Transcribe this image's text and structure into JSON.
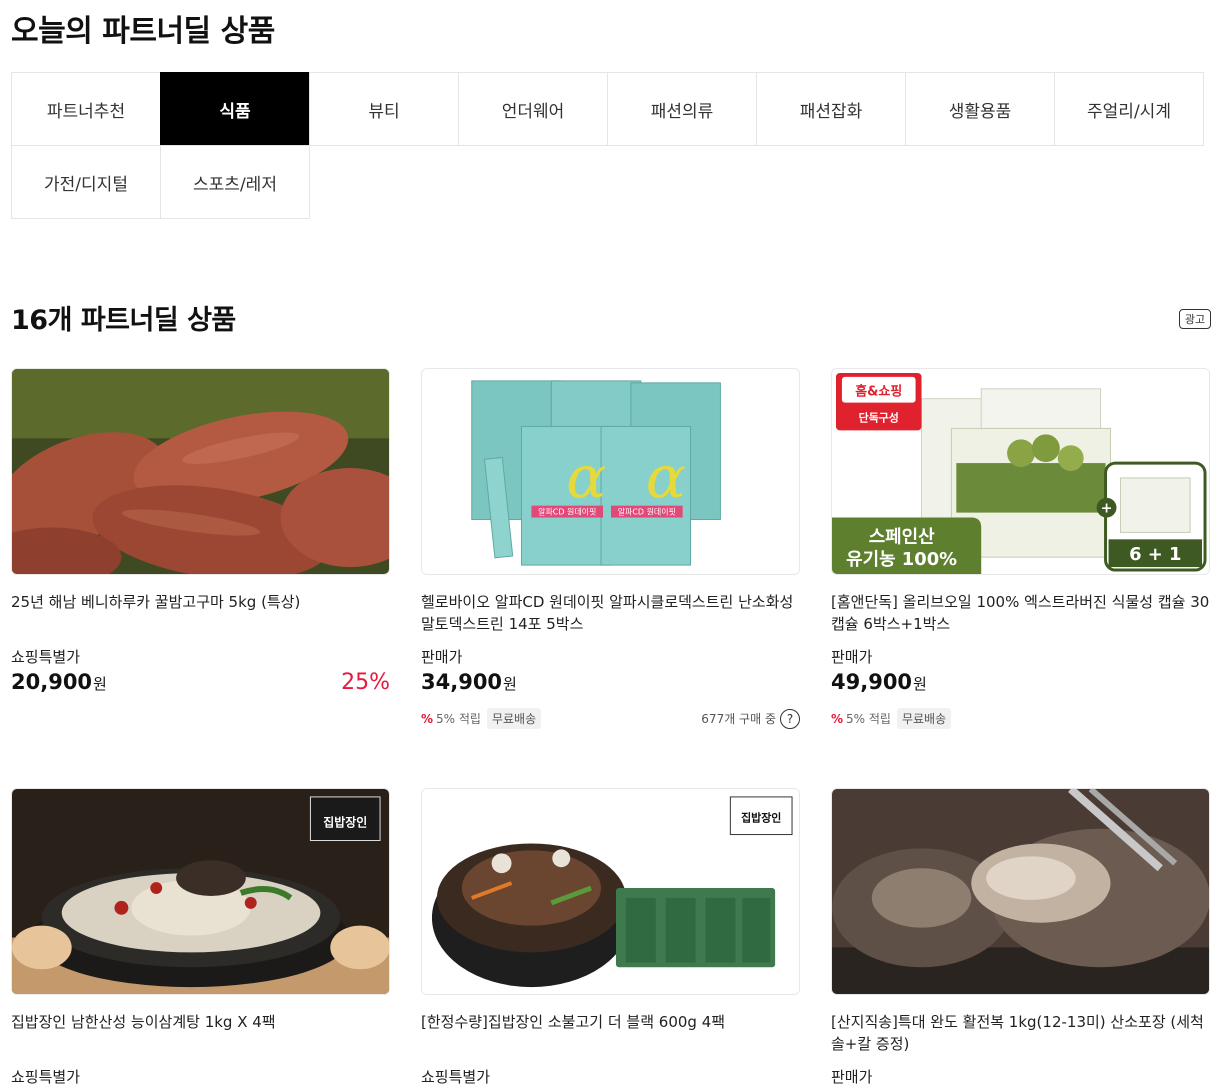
{
  "page_title": "오늘의 파트너딜 상품",
  "categories_row1": [
    {
      "label": "파트너추천",
      "active": false
    },
    {
      "label": "식품",
      "active": true
    },
    {
      "label": "뷰티",
      "active": false
    },
    {
      "label": "언더웨어",
      "active": false
    },
    {
      "label": "패션의류",
      "active": false
    },
    {
      "label": "패션잡화",
      "active": false
    },
    {
      "label": "생활용품",
      "active": false
    },
    {
      "label": "주얼리/시계",
      "active": false
    }
  ],
  "categories_row2": [
    {
      "label": "가전/디지털",
      "active": false
    },
    {
      "label": "스포츠/레저",
      "active": false
    }
  ],
  "section_title": "16개 파트너딜 상품",
  "ad_badge": "광고",
  "products": [
    {
      "name": "25년 해남 베니하루카 꿀밤고구마 5kg (특상)",
      "price_label": "쇼핑특별가",
      "price": "20,900",
      "currency": "원",
      "discount": "25%"
    },
    {
      "name": "헬로바이오 알파CD 원데이핏 알파시클로덱스트린 난소화성말토덱스트린 14포 5박스",
      "price_label": "판매가",
      "price": "34,900",
      "currency": "원",
      "point_pct": "%",
      "point_text": "5% 적립",
      "free_ship": "무료배송",
      "buy_count": "677개 구매 중",
      "help": "?"
    },
    {
      "name": "[홈앤단독] 올리브오일 100% 엑스트라버진 식물성 캡슐 30캡슐 6박스+1박스",
      "price_label": "판매가",
      "price": "49,900",
      "currency": "원",
      "point_pct": "%",
      "point_text": "5% 적립",
      "free_ship": "무료배송"
    },
    {
      "name": "집밥장인 남한산성 능이삼계탕 1kg X 4팩",
      "price_label": "쇼핑특별가"
    },
    {
      "name": "[한정수량]집밥장인 소불고기 더 블랙 600g 4팩",
      "price_label": "쇼핑특별가"
    },
    {
      "name": "[산지직송]특대 완도 활전복 1kg(12-13미) 산소포장 (세척솔+칼 증정)",
      "price_label": "판매가"
    }
  ],
  "image_text": {
    "homeshop_logo": "홈&쇼핑",
    "homeshop_sub": "단독구성",
    "olive_banner_1": "스페인산",
    "olive_banner_2": "유기농 100%",
    "olive_bonus": "6 + 1",
    "alpha_box_label": "알파CD 원데이핏",
    "jipbap_logo": "집밥장인"
  },
  "colors": {
    "accent_red": "#e8193c",
    "active_tab_bg": "#000000"
  }
}
